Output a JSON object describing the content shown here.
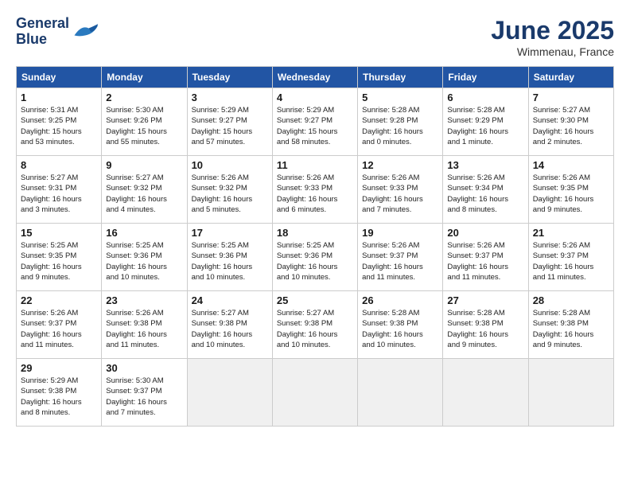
{
  "header": {
    "logo_line1": "General",
    "logo_line2": "Blue",
    "month": "June 2025",
    "location": "Wimmenau, France"
  },
  "weekdays": [
    "Sunday",
    "Monday",
    "Tuesday",
    "Wednesday",
    "Thursday",
    "Friday",
    "Saturday"
  ],
  "weeks": [
    [
      {
        "day": 1,
        "info": "Sunrise: 5:31 AM\nSunset: 9:25 PM\nDaylight: 15 hours\nand 53 minutes."
      },
      {
        "day": 2,
        "info": "Sunrise: 5:30 AM\nSunset: 9:26 PM\nDaylight: 15 hours\nand 55 minutes."
      },
      {
        "day": 3,
        "info": "Sunrise: 5:29 AM\nSunset: 9:27 PM\nDaylight: 15 hours\nand 57 minutes."
      },
      {
        "day": 4,
        "info": "Sunrise: 5:29 AM\nSunset: 9:27 PM\nDaylight: 15 hours\nand 58 minutes."
      },
      {
        "day": 5,
        "info": "Sunrise: 5:28 AM\nSunset: 9:28 PM\nDaylight: 16 hours\nand 0 minutes."
      },
      {
        "day": 6,
        "info": "Sunrise: 5:28 AM\nSunset: 9:29 PM\nDaylight: 16 hours\nand 1 minute."
      },
      {
        "day": 7,
        "info": "Sunrise: 5:27 AM\nSunset: 9:30 PM\nDaylight: 16 hours\nand 2 minutes."
      }
    ],
    [
      {
        "day": 8,
        "info": "Sunrise: 5:27 AM\nSunset: 9:31 PM\nDaylight: 16 hours\nand 3 minutes."
      },
      {
        "day": 9,
        "info": "Sunrise: 5:27 AM\nSunset: 9:32 PM\nDaylight: 16 hours\nand 4 minutes."
      },
      {
        "day": 10,
        "info": "Sunrise: 5:26 AM\nSunset: 9:32 PM\nDaylight: 16 hours\nand 5 minutes."
      },
      {
        "day": 11,
        "info": "Sunrise: 5:26 AM\nSunset: 9:33 PM\nDaylight: 16 hours\nand 6 minutes."
      },
      {
        "day": 12,
        "info": "Sunrise: 5:26 AM\nSunset: 9:33 PM\nDaylight: 16 hours\nand 7 minutes."
      },
      {
        "day": 13,
        "info": "Sunrise: 5:26 AM\nSunset: 9:34 PM\nDaylight: 16 hours\nand 8 minutes."
      },
      {
        "day": 14,
        "info": "Sunrise: 5:26 AM\nSunset: 9:35 PM\nDaylight: 16 hours\nand 9 minutes."
      }
    ],
    [
      {
        "day": 15,
        "info": "Sunrise: 5:25 AM\nSunset: 9:35 PM\nDaylight: 16 hours\nand 9 minutes."
      },
      {
        "day": 16,
        "info": "Sunrise: 5:25 AM\nSunset: 9:36 PM\nDaylight: 16 hours\nand 10 minutes."
      },
      {
        "day": 17,
        "info": "Sunrise: 5:25 AM\nSunset: 9:36 PM\nDaylight: 16 hours\nand 10 minutes."
      },
      {
        "day": 18,
        "info": "Sunrise: 5:25 AM\nSunset: 9:36 PM\nDaylight: 16 hours\nand 10 minutes."
      },
      {
        "day": 19,
        "info": "Sunrise: 5:26 AM\nSunset: 9:37 PM\nDaylight: 16 hours\nand 11 minutes."
      },
      {
        "day": 20,
        "info": "Sunrise: 5:26 AM\nSunset: 9:37 PM\nDaylight: 16 hours\nand 11 minutes."
      },
      {
        "day": 21,
        "info": "Sunrise: 5:26 AM\nSunset: 9:37 PM\nDaylight: 16 hours\nand 11 minutes."
      }
    ],
    [
      {
        "day": 22,
        "info": "Sunrise: 5:26 AM\nSunset: 9:37 PM\nDaylight: 16 hours\nand 11 minutes."
      },
      {
        "day": 23,
        "info": "Sunrise: 5:26 AM\nSunset: 9:38 PM\nDaylight: 16 hours\nand 11 minutes."
      },
      {
        "day": 24,
        "info": "Sunrise: 5:27 AM\nSunset: 9:38 PM\nDaylight: 16 hours\nand 10 minutes."
      },
      {
        "day": 25,
        "info": "Sunrise: 5:27 AM\nSunset: 9:38 PM\nDaylight: 16 hours\nand 10 minutes."
      },
      {
        "day": 26,
        "info": "Sunrise: 5:28 AM\nSunset: 9:38 PM\nDaylight: 16 hours\nand 10 minutes."
      },
      {
        "day": 27,
        "info": "Sunrise: 5:28 AM\nSunset: 9:38 PM\nDaylight: 16 hours\nand 9 minutes."
      },
      {
        "day": 28,
        "info": "Sunrise: 5:28 AM\nSunset: 9:38 PM\nDaylight: 16 hours\nand 9 minutes."
      }
    ],
    [
      {
        "day": 29,
        "info": "Sunrise: 5:29 AM\nSunset: 9:38 PM\nDaylight: 16 hours\nand 8 minutes."
      },
      {
        "day": 30,
        "info": "Sunrise: 5:30 AM\nSunset: 9:37 PM\nDaylight: 16 hours\nand 7 minutes."
      },
      null,
      null,
      null,
      null,
      null
    ]
  ]
}
